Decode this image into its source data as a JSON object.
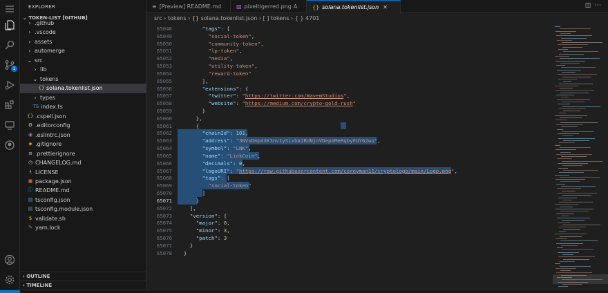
{
  "explorer": {
    "title": "EXPLORER",
    "root": "TOKEN-LIST [GITHUB]",
    "items": [
      {
        "label": ".github",
        "depth": 1,
        "chevron": ">",
        "icon": ""
      },
      {
        "label": ".vscode",
        "depth": 1,
        "chevron": ">",
        "icon": ""
      },
      {
        "label": "assets",
        "depth": 1,
        "chevron": ">",
        "icon": ""
      },
      {
        "label": "automerge",
        "depth": 1,
        "chevron": ">",
        "icon": ""
      },
      {
        "label": "src",
        "depth": 1,
        "chevron": "v",
        "icon": ""
      },
      {
        "label": "lib",
        "depth": 2,
        "chevron": ">",
        "icon": ""
      },
      {
        "label": "tokens",
        "depth": 2,
        "chevron": "v",
        "icon": ""
      },
      {
        "label": "solana.tokenlist.json",
        "depth": 3,
        "chevron": "",
        "icon": "{}",
        "selected": true
      },
      {
        "label": "types",
        "depth": 2,
        "chevron": ">",
        "icon": ""
      },
      {
        "label": "index.ts",
        "depth": 2,
        "chevron": "",
        "icon": "TS"
      },
      {
        "label": ".cspell.json",
        "depth": 1,
        "chevron": "",
        "icon": "{}"
      },
      {
        "label": ".editorconfig",
        "depth": 1,
        "chevron": "",
        "icon": "⚙"
      },
      {
        "label": ".eslintrc.json",
        "depth": 1,
        "chevron": "",
        "icon": "◉"
      },
      {
        "label": ".gitignore",
        "depth": 1,
        "chevron": "",
        "icon": "◆"
      },
      {
        "label": ".prettierignore",
        "depth": 1,
        "chevron": "",
        "icon": "≡"
      },
      {
        "label": "CHANGELOG.md",
        "depth": 1,
        "chevron": "",
        "icon": "◷"
      },
      {
        "label": "LICENSE",
        "depth": 1,
        "chevron": "",
        "icon": "♗"
      },
      {
        "label": "package.json",
        "depth": 1,
        "chevron": "",
        "icon": "▣"
      },
      {
        "label": "README.md",
        "depth": 1,
        "chevron": "",
        "icon": "ⓘ"
      },
      {
        "label": "tsconfig.json",
        "depth": 1,
        "chevron": "",
        "icon": "▤"
      },
      {
        "label": "tsconfig.module.json",
        "depth": 1,
        "chevron": "",
        "icon": "▤"
      },
      {
        "label": "validate.sh",
        "depth": 1,
        "chevron": "",
        "icon": "$"
      },
      {
        "label": "yarn.lock",
        "depth": 1,
        "chevron": "",
        "icon": "✎"
      }
    ],
    "outline": "OUTLINE",
    "timeline": "TIMELINE"
  },
  "tabs": [
    {
      "icon": "≡",
      "label": "[Preview] README.md",
      "modified": "",
      "active": false
    },
    {
      "icon": "▨",
      "label": "pixeltigerred.png",
      "modified": "A",
      "active": false
    },
    {
      "icon": "{}",
      "label": "solana.tokenlist.json",
      "modified": "",
      "active": true
    }
  ],
  "breadcrumb": {
    "parts": [
      "src",
      "tokens",
      "solana.tokenlist.json",
      "[ ] tokens",
      "{ } 4701"
    ]
  },
  "source_control_badge": "1",
  "colors": {
    "accent": "#0078d4",
    "selection": "#264f78",
    "key": "#9cdcfe",
    "string": "#ce9178",
    "number": "#b5cea8"
  },
  "editor": {
    "current_line": "65071",
    "lines": [
      {
        "n": "65048",
        "code": [
          [
            "p",
            "        "
          ],
          [
            "k",
            "\"tags\""
          ],
          [
            "p",
            ": ["
          ]
        ]
      },
      {
        "n": "65049",
        "code": [
          [
            "p",
            "          "
          ],
          [
            "s",
            "\"social-token\""
          ],
          [
            "p",
            ","
          ]
        ]
      },
      {
        "n": "65050",
        "code": [
          [
            "p",
            "          "
          ],
          [
            "s",
            "\"community-token\""
          ],
          [
            "p",
            ","
          ]
        ]
      },
      {
        "n": "65051",
        "code": [
          [
            "p",
            "          "
          ],
          [
            "s",
            "\"lp-token\""
          ],
          [
            "p",
            ","
          ]
        ]
      },
      {
        "n": "65052",
        "code": [
          [
            "p",
            "          "
          ],
          [
            "s",
            "\"media\""
          ],
          [
            "p",
            ","
          ]
        ]
      },
      {
        "n": "65053",
        "code": [
          [
            "p",
            "          "
          ],
          [
            "s",
            "\"utility-token\""
          ],
          [
            "p",
            ","
          ]
        ]
      },
      {
        "n": "65054",
        "code": [
          [
            "p",
            "          "
          ],
          [
            "s",
            "\"reward-token\""
          ]
        ]
      },
      {
        "n": "65055",
        "code": [
          [
            "p",
            "        ],"
          ]
        ]
      },
      {
        "n": "65056",
        "code": [
          [
            "p",
            "        "
          ],
          [
            "k",
            "\"extensions\""
          ],
          [
            "p",
            ": {"
          ]
        ]
      },
      {
        "n": "65057",
        "code": [
          [
            "p",
            "          "
          ],
          [
            "k",
            "\"twitter\""
          ],
          [
            "p",
            ": "
          ],
          [
            "s",
            "\""
          ],
          [
            "u",
            "https://twitter.com/WavemStudios"
          ],
          [
            "s",
            "\""
          ],
          [
            "p",
            ","
          ]
        ]
      },
      {
        "n": "65058",
        "code": [
          [
            "p",
            "          "
          ],
          [
            "k",
            "\"website\""
          ],
          [
            "p",
            ": "
          ],
          [
            "s",
            "\""
          ],
          [
            "u",
            "https://medium.com/crypto-gold-rush"
          ],
          [
            "s",
            "\""
          ]
        ]
      },
      {
        "n": "65059",
        "code": [
          [
            "p",
            "        }"
          ]
        ]
      },
      {
        "n": "65060",
        "code": [
          [
            "p",
            "      },"
          ]
        ]
      },
      {
        "n": "65061",
        "code": [
          [
            "p",
            "      {"
          ]
        ],
        "sel": [
          236,
          8
        ]
      },
      {
        "n": "65062",
        "code": [
          [
            "p",
            "        "
          ],
          [
            "k",
            "\"chainId\""
          ],
          [
            "p",
            ": "
          ],
          [
            "n",
            "101"
          ],
          [
            "p",
            ","
          ]
        ],
        "sel": [
          0,
          101
        ]
      },
      {
        "n": "65063",
        "code": [
          [
            "p",
            "        "
          ],
          [
            "k",
            "\"address\""
          ],
          [
            "p",
            ": "
          ],
          [
            "s",
            "\"3NVoDmpdXK3nv1ySixhA1RdNjnVDepGMeRqbyFUY62wu\""
          ],
          [
            "p",
            ","
          ]
        ],
        "sel": [
          0,
          288
        ]
      },
      {
        "n": "65064",
        "code": [
          [
            "p",
            "        "
          ],
          [
            "k",
            "\"symbol\""
          ],
          [
            "p",
            ": "
          ],
          [
            "s",
            "\"LNK\""
          ],
          [
            "p",
            ","
          ]
        ],
        "sel": [
          0,
          104
        ]
      },
      {
        "n": "65065",
        "code": [
          [
            "p",
            "        "
          ],
          [
            "k",
            "\"name\""
          ],
          [
            "p",
            ": "
          ],
          [
            "s",
            "\"LinkCoin\""
          ],
          [
            "p",
            ","
          ]
        ],
        "sel": [
          0,
          118
        ]
      },
      {
        "n": "65066",
        "code": [
          [
            "p",
            "        "
          ],
          [
            "k",
            "\"decimals\""
          ],
          [
            "p",
            ": "
          ],
          [
            "n",
            "0"
          ],
          [
            "p",
            ","
          ]
        ],
        "sel": [
          0,
          94
        ]
      },
      {
        "n": "65067",
        "code": [
          [
            "p",
            "        "
          ],
          [
            "k",
            "\"logoURI\""
          ],
          [
            "p",
            ": "
          ],
          [
            "s",
            "\""
          ],
          [
            "u",
            "https://raw.githubusercontent.com/coreyman11/cryptologo/main/Logo.png"
          ],
          [
            "s",
            "\""
          ],
          [
            "p",
            ","
          ]
        ],
        "sel": [
          0,
          396
        ]
      },
      {
        "n": "65068",
        "code": [
          [
            "p",
            "        "
          ],
          [
            "k",
            "\"tags\""
          ],
          [
            "p",
            ": ["
          ]
        ],
        "sel": [
          0,
          71
        ]
      },
      {
        "n": "65069",
        "code": [
          [
            "p",
            "          "
          ],
          [
            "s",
            "\"social-token\""
          ]
        ],
        "sel": [
          0,
          104
        ]
      },
      {
        "n": "65070",
        "code": [
          [
            "p",
            "        ]"
          ]
        ],
        "sel": [
          0,
          36
        ]
      },
      {
        "n": "65071",
        "code": [
          [
            "p",
            "      }"
          ]
        ],
        "sel": [
          0,
          28
        ]
      },
      {
        "n": "65072",
        "code": [
          [
            "p",
            "    ],"
          ]
        ]
      },
      {
        "n": "65073",
        "code": [
          [
            "p",
            "    "
          ],
          [
            "k",
            "\"version\""
          ],
          [
            "p",
            ": {"
          ]
        ]
      },
      {
        "n": "65074",
        "code": [
          [
            "p",
            "      "
          ],
          [
            "k",
            "\"major\""
          ],
          [
            "p",
            ": "
          ],
          [
            "n",
            "0"
          ],
          [
            "p",
            ","
          ]
        ]
      },
      {
        "n": "65075",
        "code": [
          [
            "p",
            "      "
          ],
          [
            "k",
            "\"minor\""
          ],
          [
            "p",
            ": "
          ],
          [
            "n",
            "3"
          ],
          [
            "p",
            ","
          ]
        ]
      },
      {
        "n": "65076",
        "code": [
          [
            "p",
            "      "
          ],
          [
            "k",
            "\"patch\""
          ],
          [
            "p",
            ": "
          ],
          [
            "n",
            "3"
          ]
        ]
      },
      {
        "n": "65077",
        "code": [
          [
            "p",
            "    }"
          ]
        ]
      },
      {
        "n": "65078",
        "code": [
          [
            "p",
            "  }"
          ]
        ]
      }
    ]
  }
}
